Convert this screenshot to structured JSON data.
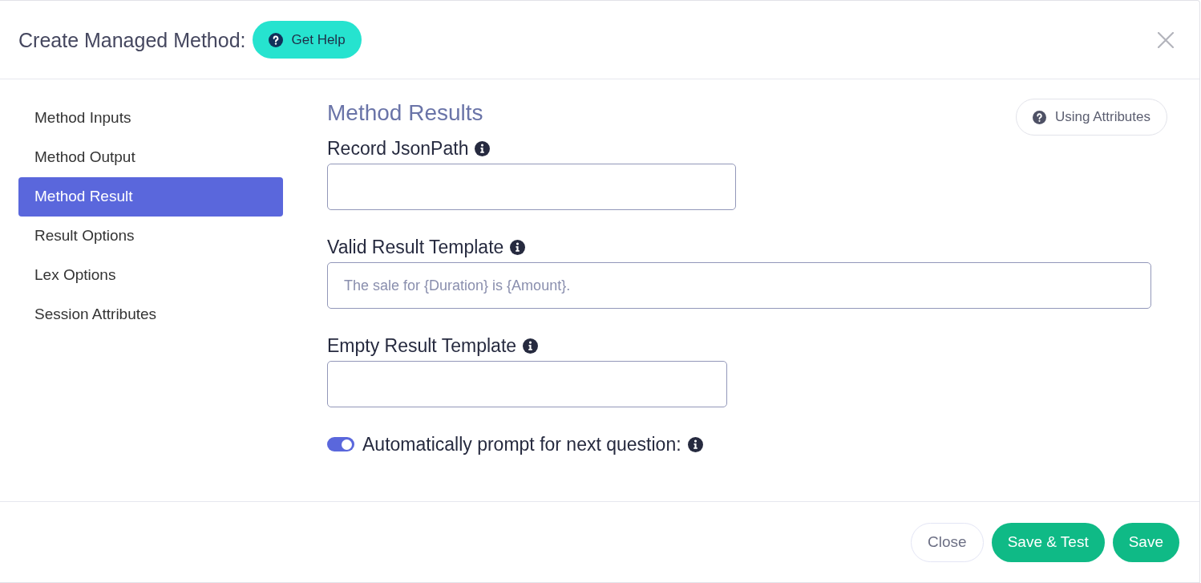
{
  "dialog": {
    "title": "Create Managed Method:",
    "help_button": "Get Help"
  },
  "sidebar": {
    "items": [
      {
        "label": "Method Inputs",
        "selected": false
      },
      {
        "label": "Method Output",
        "selected": false
      },
      {
        "label": "Method Result",
        "selected": true
      },
      {
        "label": "Result Options",
        "selected": false
      },
      {
        "label": "Lex Options",
        "selected": false
      },
      {
        "label": "Session Attributes",
        "selected": false
      }
    ]
  },
  "content": {
    "title": "Method Results",
    "attributes_button": "Using Attributes",
    "fields": [
      {
        "label": "Record JsonPath"
      },
      {
        "label": "Valid Result Template",
        "placeholder": "The sale for {Duration} is {Amount}."
      },
      {
        "label": "Empty Result Template"
      }
    ],
    "toggle": {
      "label": "Automatically prompt for next question:",
      "on": true
    }
  },
  "footer": {
    "buttons": [
      {
        "label": "Close",
        "kind": "secondary"
      },
      {
        "label": "Save & Test",
        "kind": "primary"
      },
      {
        "label": "Save",
        "kind": "primary"
      }
    ]
  }
}
